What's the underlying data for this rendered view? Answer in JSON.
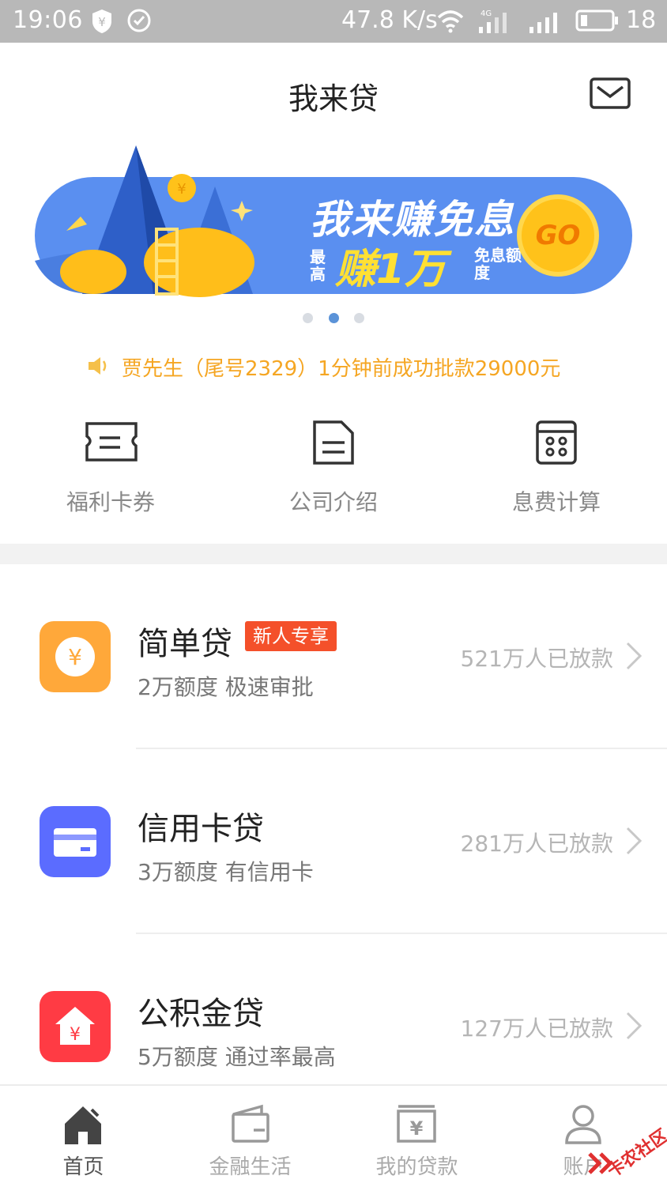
{
  "status_bar": {
    "time": "19:06",
    "speed": "47.8 K/s",
    "battery": "18",
    "network": "4G"
  },
  "header": {
    "title": "我来贷"
  },
  "banner": {
    "headline": "我来赚免息",
    "sub_prefix": "最高",
    "sub_highlight": "赚1万",
    "sub_suffix": "免息额度",
    "go": "GO",
    "page_count": 3,
    "active_page": 2
  },
  "notice": {
    "text": "贾先生（尾号2329）1分钟前成功批款29000元"
  },
  "quick_actions": [
    {
      "label": "福利卡券",
      "icon": "coupon-icon"
    },
    {
      "label": "公司介绍",
      "icon": "document-icon"
    },
    {
      "label": "息费计算",
      "icon": "calculator-icon"
    }
  ],
  "loans": [
    {
      "name": "简单贷",
      "tag": "新人专享",
      "desc": "2万额度 极速审批",
      "count": "521万人已放款",
      "color": "#ffa83a",
      "icon": "yen-coin-icon"
    },
    {
      "name": "信用卡贷",
      "tag": "",
      "desc": "3万额度 有信用卡",
      "count": "281万人已放款",
      "color": "#5b6cff",
      "icon": "credit-card-icon"
    },
    {
      "name": "公积金贷",
      "tag": "",
      "desc": "5万额度 通过率最高",
      "count": "127万人已放款",
      "color": "#ff3b44",
      "icon": "house-yen-icon"
    }
  ],
  "tabs": [
    {
      "label": "首页",
      "icon": "home-icon",
      "active": true
    },
    {
      "label": "金融生活",
      "icon": "wallet-icon",
      "active": false
    },
    {
      "label": "我的贷款",
      "icon": "loan-box-icon",
      "active": false
    },
    {
      "label": "账户",
      "icon": "user-icon",
      "active": false
    }
  ],
  "watermark": "卡农社区"
}
